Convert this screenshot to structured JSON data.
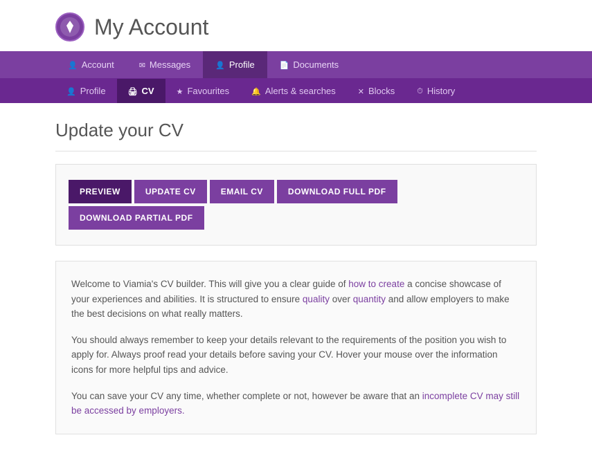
{
  "header": {
    "title": "My Account",
    "logo_alt": "Viamia logo"
  },
  "primary_nav": {
    "items": [
      {
        "id": "account",
        "label": "Account",
        "icon": "account",
        "active": false
      },
      {
        "id": "messages",
        "label": "Messages",
        "icon": "messages",
        "active": false
      },
      {
        "id": "profile",
        "label": "Profile",
        "icon": "profile",
        "active": true
      },
      {
        "id": "documents",
        "label": "Documents",
        "icon": "documents",
        "active": false
      }
    ]
  },
  "secondary_nav": {
    "items": [
      {
        "id": "profile",
        "label": "Profile",
        "icon": "profile",
        "active": false
      },
      {
        "id": "cv",
        "label": "CV",
        "icon": "cv",
        "active": true
      },
      {
        "id": "favourites",
        "label": "Favourites",
        "icon": "favourites",
        "active": false
      },
      {
        "id": "alerts",
        "label": "Alerts & searches",
        "icon": "alerts",
        "active": false
      },
      {
        "id": "blocks",
        "label": "Blocks",
        "icon": "blocks",
        "active": false
      },
      {
        "id": "history",
        "label": "History",
        "icon": "history",
        "active": false
      }
    ]
  },
  "page_title": "Update your CV",
  "cv_buttons": [
    {
      "id": "preview",
      "label": "PREVIEW",
      "active": true
    },
    {
      "id": "update-cv",
      "label": "UPDATE CV",
      "active": false
    },
    {
      "id": "email-cv",
      "label": "EMAIL CV",
      "active": false
    },
    {
      "id": "download-full-pdf",
      "label": "DOWNLOAD FULL PDF",
      "active": false
    },
    {
      "id": "download-partial-pdf",
      "label": "DOWNLOAD PARTIAL PDF",
      "active": false
    }
  ],
  "info_paragraphs": [
    {
      "id": "p1",
      "text": "Welcome to Viamia's CV builder. This will give you a clear guide of how to create a concise showcase of your experiences and abilities. It is structured to ensure quality over quantity and allow employers to make the best decisions on what really matters."
    },
    {
      "id": "p2",
      "text": "You should always remember to keep your details relevant to the requirements of the position you wish to apply for. Always proof read your details before saving your CV. Hover your mouse over the information icons for more helpful tips and advice."
    },
    {
      "id": "p3",
      "text": "You can save your CV any time, whether complete or not, however be aware that an incomplete CV may still be accessed by employers."
    }
  ]
}
